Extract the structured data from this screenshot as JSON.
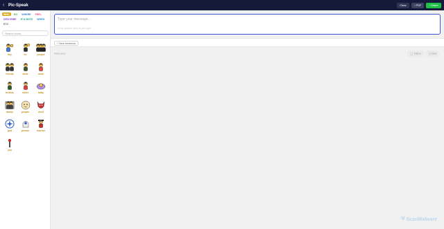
{
  "app": {
    "back_icon": "chevron-left-icon",
    "title": "Pic-Speak"
  },
  "toolbar": {
    "clear_label": "Clear",
    "pdf_label": "PDF",
    "share_label": "Share"
  },
  "sidebar": {
    "tabs": [
      {
        "label": "WHO",
        "color": "#ffffff",
        "active": true
      },
      {
        "label": "DO",
        "color": "#3aaa35"
      },
      {
        "label": "WHERE",
        "color": "#3a7bd5"
      },
      {
        "label": "FEEL",
        "color": "#e14e86"
      },
      {
        "label": "DESCRIBE",
        "color": "#8a4fd6"
      },
      {
        "label": "IF & BUTS",
        "color": "#1f9e8f"
      },
      {
        "label": "WHEN",
        "color": "#2b8ed6"
      },
      {
        "label": "ETC",
        "color": "#666666"
      }
    ],
    "search_placeholder": "Search icons...",
    "icons": [
      {
        "label": "boy",
        "icon": "boy-icon"
      },
      {
        "label": "he",
        "icon": "he-icon"
      },
      {
        "label": "people",
        "icon": "people-icon"
      },
      {
        "label": "friends",
        "icon": "friends-icon"
      },
      {
        "label": "dude",
        "icon": "dude-icon"
      },
      {
        "label": "mum",
        "icon": "mum-icon"
      },
      {
        "label": "brother",
        "icon": "brother-icon"
      },
      {
        "label": "sister",
        "icon": "sister-icon"
      },
      {
        "label": "baby",
        "icon": "baby-icon"
      },
      {
        "label": "family",
        "icon": "family-icon"
      },
      {
        "label": "people",
        "icon": "crowd-icon"
      },
      {
        "label": "devil",
        "icon": "devil-icon"
      },
      {
        "label": "god",
        "icon": "god-icon"
      },
      {
        "label": "person",
        "icon": "ghost-person-icon"
      },
      {
        "label": "teacher",
        "icon": "teacher-icon"
      },
      {
        "label": "you",
        "icon": "you-icon"
      }
    ]
  },
  "composer": {
    "placeholder": "Type your message...",
    "hint": "Icons appear here as you type"
  },
  "sentences": {
    "new_label": "+ New sentence"
  },
  "preview": {
    "label": "PREVIEW",
    "titles_label": "Titles",
    "dist_label": "Dist"
  },
  "watermark": {
    "text": "ScanMalware"
  }
}
